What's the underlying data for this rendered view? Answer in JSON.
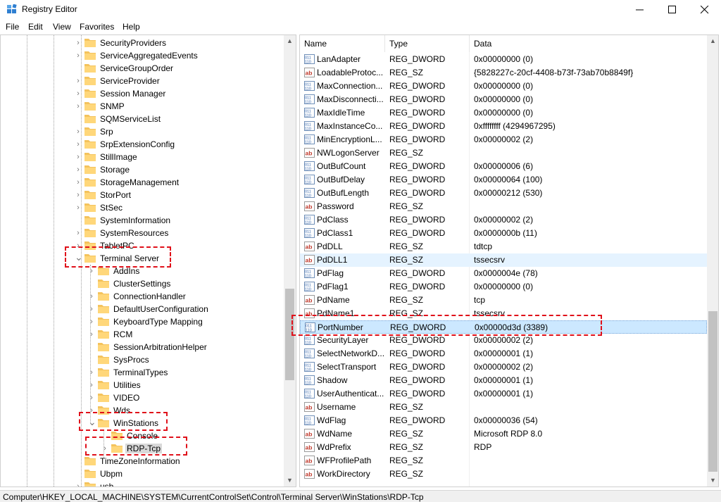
{
  "window": {
    "title": "Registry Editor"
  },
  "menu": [
    "File",
    "Edit",
    "View",
    "Favorites",
    "Help"
  ],
  "tree": {
    "items": [
      {
        "label": "SecurityProviders",
        "level": 1,
        "expander": "collapsed"
      },
      {
        "label": "ServiceAggregatedEvents",
        "level": 1,
        "expander": "collapsed"
      },
      {
        "label": "ServiceGroupOrder",
        "level": 1,
        "expander": "none"
      },
      {
        "label": "ServiceProvider",
        "level": 1,
        "expander": "collapsed"
      },
      {
        "label": "Session Manager",
        "level": 1,
        "expander": "collapsed"
      },
      {
        "label": "SNMP",
        "level": 1,
        "expander": "collapsed"
      },
      {
        "label": "SQMServiceList",
        "level": 1,
        "expander": "none"
      },
      {
        "label": "Srp",
        "level": 1,
        "expander": "collapsed"
      },
      {
        "label": "SrpExtensionConfig",
        "level": 1,
        "expander": "collapsed"
      },
      {
        "label": "StillImage",
        "level": 1,
        "expander": "collapsed"
      },
      {
        "label": "Storage",
        "level": 1,
        "expander": "collapsed"
      },
      {
        "label": "StorageManagement",
        "level": 1,
        "expander": "collapsed"
      },
      {
        "label": "StorPort",
        "level": 1,
        "expander": "collapsed"
      },
      {
        "label": "StSec",
        "level": 1,
        "expander": "collapsed"
      },
      {
        "label": "SystemInformation",
        "level": 1,
        "expander": "none"
      },
      {
        "label": "SystemResources",
        "level": 1,
        "expander": "collapsed"
      },
      {
        "label": "TabletPC",
        "level": 1,
        "expander": "collapsed"
      },
      {
        "label": "Terminal Server",
        "level": 1,
        "expander": "expanded"
      },
      {
        "label": "AddIns",
        "level": 2,
        "expander": "collapsed"
      },
      {
        "label": "ClusterSettings",
        "level": 2,
        "expander": "none"
      },
      {
        "label": "ConnectionHandler",
        "level": 2,
        "expander": "collapsed"
      },
      {
        "label": "DefaultUserConfiguration",
        "level": 2,
        "expander": "collapsed"
      },
      {
        "label": "KeyboardType Mapping",
        "level": 2,
        "expander": "collapsed"
      },
      {
        "label": "RCM",
        "level": 2,
        "expander": "collapsed"
      },
      {
        "label": "SessionArbitrationHelper",
        "level": 2,
        "expander": "none"
      },
      {
        "label": "SysProcs",
        "level": 2,
        "expander": "none"
      },
      {
        "label": "TerminalTypes",
        "level": 2,
        "expander": "collapsed"
      },
      {
        "label": "Utilities",
        "level": 2,
        "expander": "collapsed"
      },
      {
        "label": "VIDEO",
        "level": 2,
        "expander": "collapsed"
      },
      {
        "label": "Wds",
        "level": 2,
        "expander": "collapsed"
      },
      {
        "label": "WinStations",
        "level": 2,
        "expander": "expanded"
      },
      {
        "label": "Console",
        "level": 3,
        "expander": "none"
      },
      {
        "label": "RDP-Tcp",
        "level": 3,
        "expander": "collapsed",
        "selected": true
      },
      {
        "label": "TimeZoneInformation",
        "level": 1,
        "expander": "none"
      },
      {
        "label": "Ubpm",
        "level": 1,
        "expander": "none"
      },
      {
        "label": "usb",
        "level": 1,
        "expander": "collapsed"
      }
    ]
  },
  "list": {
    "columns": [
      "Name",
      "Type",
      "Data"
    ],
    "rows": [
      {
        "icon": "dword",
        "name": "LanAdapter",
        "type": "REG_DWORD",
        "data": "0x00000000 (0)"
      },
      {
        "icon": "string",
        "name": "LoadableProtoc...",
        "type": "REG_SZ",
        "data": "{5828227c-20cf-4408-b73f-73ab70b8849f}"
      },
      {
        "icon": "dword",
        "name": "MaxConnection...",
        "type": "REG_DWORD",
        "data": "0x00000000 (0)"
      },
      {
        "icon": "dword",
        "name": "MaxDisconnecti...",
        "type": "REG_DWORD",
        "data": "0x00000000 (0)"
      },
      {
        "icon": "dword",
        "name": "MaxIdleTime",
        "type": "REG_DWORD",
        "data": "0x00000000 (0)"
      },
      {
        "icon": "dword",
        "name": "MaxInstanceCo...",
        "type": "REG_DWORD",
        "data": "0xffffffff (4294967295)"
      },
      {
        "icon": "dword",
        "name": "MinEncryptionL...",
        "type": "REG_DWORD",
        "data": "0x00000002 (2)"
      },
      {
        "icon": "string",
        "name": "NWLogonServer",
        "type": "REG_SZ",
        "data": ""
      },
      {
        "icon": "dword",
        "name": "OutBufCount",
        "type": "REG_DWORD",
        "data": "0x00000006 (6)"
      },
      {
        "icon": "dword",
        "name": "OutBufDelay",
        "type": "REG_DWORD",
        "data": "0x00000064 (100)"
      },
      {
        "icon": "dword",
        "name": "OutBufLength",
        "type": "REG_DWORD",
        "data": "0x00000212 (530)"
      },
      {
        "icon": "string",
        "name": "Password",
        "type": "REG_SZ",
        "data": ""
      },
      {
        "icon": "dword",
        "name": "PdClass",
        "type": "REG_DWORD",
        "data": "0x00000002 (2)"
      },
      {
        "icon": "dword",
        "name": "PdClass1",
        "type": "REG_DWORD",
        "data": "0x0000000b (11)"
      },
      {
        "icon": "string",
        "name": "PdDLL",
        "type": "REG_SZ",
        "data": "tdtcp"
      },
      {
        "icon": "string",
        "name": "PdDLL1",
        "type": "REG_SZ",
        "data": "tssecsrv",
        "state": "hover"
      },
      {
        "icon": "dword",
        "name": "PdFlag",
        "type": "REG_DWORD",
        "data": "0x0000004e (78)"
      },
      {
        "icon": "dword",
        "name": "PdFlag1",
        "type": "REG_DWORD",
        "data": "0x00000000 (0)"
      },
      {
        "icon": "string",
        "name": "PdName",
        "type": "REG_SZ",
        "data": "tcp"
      },
      {
        "icon": "string",
        "name": "PdName1",
        "type": "REG_SZ",
        "data": "tssecsrv"
      },
      {
        "icon": "dword",
        "name": "PortNumber",
        "type": "REG_DWORD",
        "data": "0x00000d3d (3389)",
        "state": "selected"
      },
      {
        "icon": "dword",
        "name": "SecurityLayer",
        "type": "REG_DWORD",
        "data": "0x00000002 (2)"
      },
      {
        "icon": "dword",
        "name": "SelectNetworkD...",
        "type": "REG_DWORD",
        "data": "0x00000001 (1)"
      },
      {
        "icon": "dword",
        "name": "SelectTransport",
        "type": "REG_DWORD",
        "data": "0x00000002 (2)"
      },
      {
        "icon": "dword",
        "name": "Shadow",
        "type": "REG_DWORD",
        "data": "0x00000001 (1)"
      },
      {
        "icon": "dword",
        "name": "UserAuthenticat...",
        "type": "REG_DWORD",
        "data": "0x00000001 (1)"
      },
      {
        "icon": "string",
        "name": "Username",
        "type": "REG_SZ",
        "data": ""
      },
      {
        "icon": "dword",
        "name": "WdFlag",
        "type": "REG_DWORD",
        "data": "0x00000036 (54)"
      },
      {
        "icon": "string",
        "name": "WdName",
        "type": "REG_SZ",
        "data": "Microsoft RDP 8.0"
      },
      {
        "icon": "string",
        "name": "WdPrefix",
        "type": "REG_SZ",
        "data": "RDP"
      },
      {
        "icon": "string",
        "name": "WFProfilePath",
        "type": "REG_SZ",
        "data": ""
      },
      {
        "icon": "string",
        "name": "WorkDirectory",
        "type": "REG_SZ",
        "data": ""
      }
    ]
  },
  "status": {
    "path": "Computer\\HKEY_LOCAL_MACHINE\\SYSTEM\\CurrentControlSet\\Control\\Terminal Server\\WinStations\\RDP-Tcp"
  },
  "colors": {
    "highlight": "#e0101a",
    "selection": "#cce8ff",
    "hover": "#e5f3ff",
    "folder": "#f4c35d"
  }
}
